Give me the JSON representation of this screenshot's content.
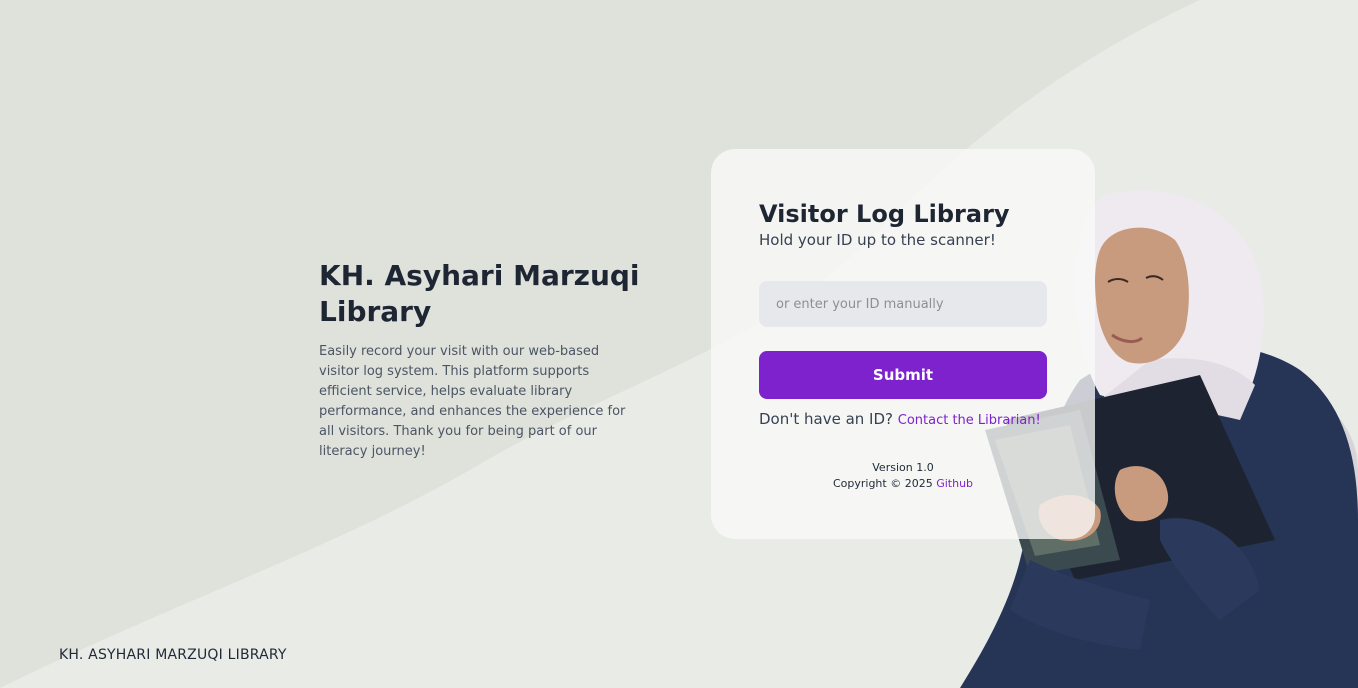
{
  "intro": {
    "title": "KH. Asyhari Marzuqi Library",
    "description": "Easily record your visit with our web-based visitor log system. This platform supports efficient service, helps evaluate library performance, and enhances the experience for all visitors. Thank you for being part of our literacy journey!"
  },
  "card": {
    "title": "Visitor Log Library",
    "subtitle": "Hold your ID up to the scanner!",
    "input_placeholder": "or enter your ID manually",
    "input_value": "",
    "submit_label": "Submit",
    "no_id_text": "Don't have an ID?",
    "contact_link": "Contact the Librarian!",
    "version": "Version 1.0",
    "copyright": "Copyright © 2025",
    "github_link": "Github"
  },
  "footer": {
    "brand": "KH. ASYHARI MARZUQI LIBRARY"
  },
  "colors": {
    "accent": "#7e22ce",
    "background": "#e6e8e3",
    "text_dark": "#1e2533"
  }
}
